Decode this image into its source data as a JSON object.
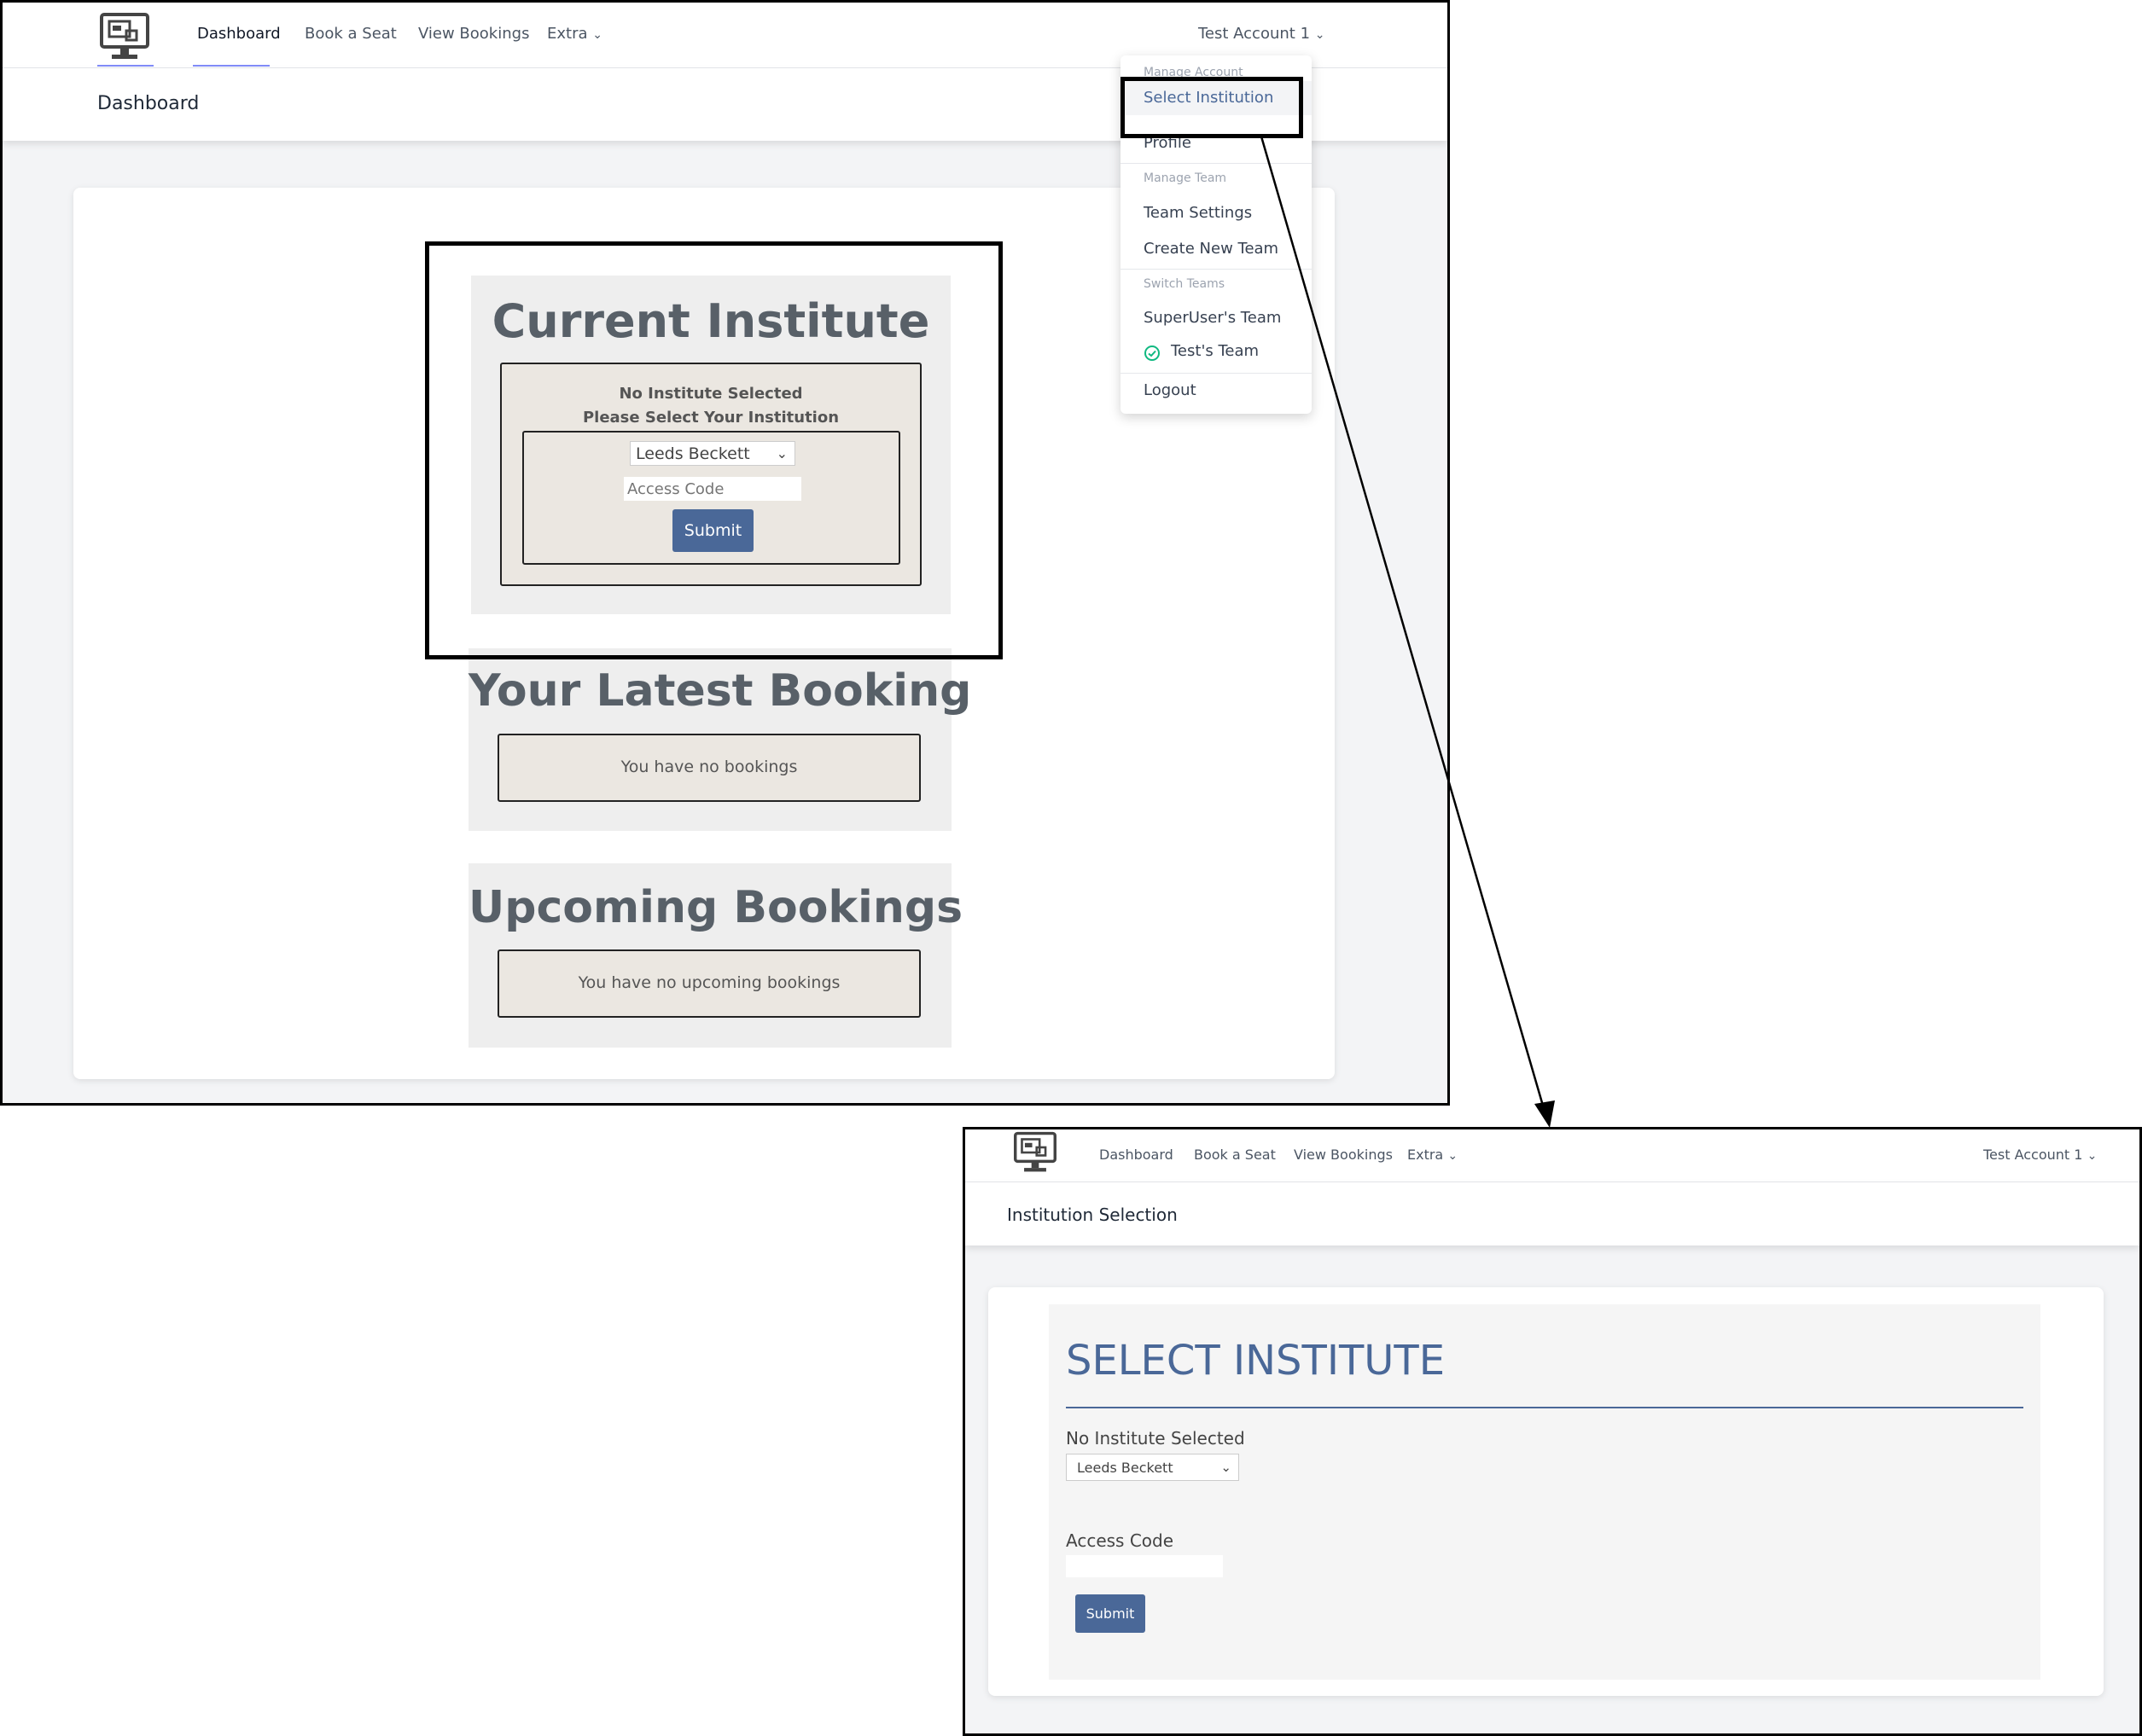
{
  "nav": {
    "links": [
      "Dashboard",
      "Book a Seat",
      "View Bookings",
      "Extra"
    ],
    "account": "Test Account 1"
  },
  "dashboard": {
    "page_title": "Dashboard",
    "current_institute": {
      "title": "Current Institute",
      "no_selection": "No Institute Selected",
      "prompt": "Please Select Your Institution",
      "select_value": "Leeds Beckett",
      "access_placeholder": "Access Code",
      "submit": "Submit"
    },
    "latest_booking": {
      "title": "Your Latest Booking",
      "message": "You have no bookings"
    },
    "upcoming": {
      "title": "Upcoming Bookings",
      "message": "You have no upcoming bookings"
    }
  },
  "dropdown": {
    "manage_account": "Manage Account",
    "select_institution": "Select Institution",
    "profile": "Profile",
    "manage_team": "Manage Team",
    "team_settings": "Team Settings",
    "create_new_team": "Create New Team",
    "switch_teams": "Switch Teams",
    "superuser_team": "SuperUser's Team",
    "test_team": "Test's Team",
    "logout": "Logout"
  },
  "institution_page": {
    "page_title": "Institution Selection",
    "heading": "SELECT INSTITUTE",
    "no_selection": "No Institute Selected",
    "select_value": "Leeds Beckett",
    "access_label": "Access Code",
    "submit": "Submit"
  },
  "colors": {
    "accent": "#4a6898",
    "heading_blue": "#4a6898",
    "check_green": "#10b981"
  }
}
